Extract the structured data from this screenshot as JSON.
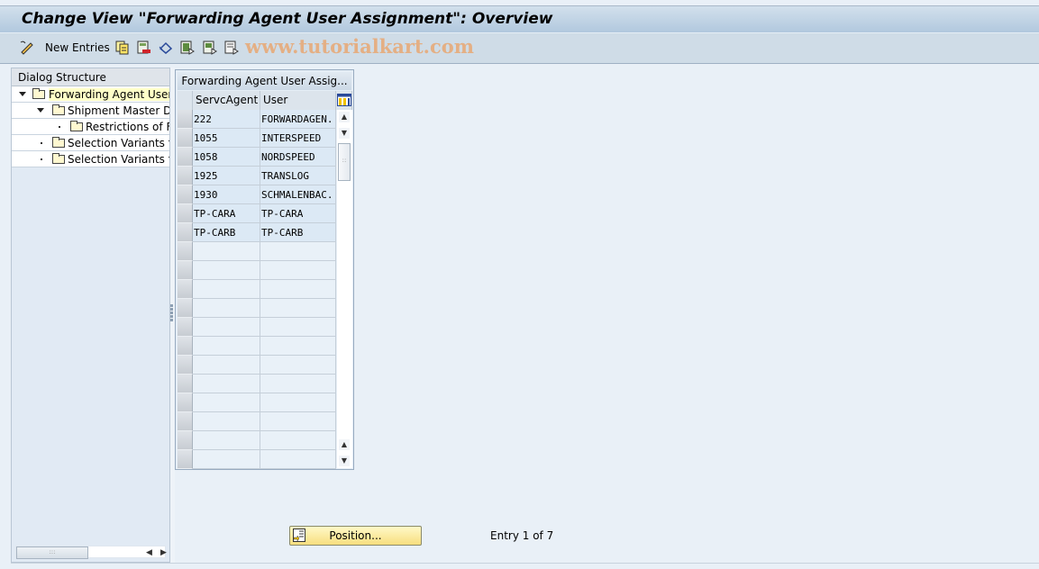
{
  "window": {
    "title": "Change View \"Forwarding Agent User Assignment\": Overview"
  },
  "toolbar": {
    "new_entries_label": "New Entries",
    "icons": [
      "change-display-icon",
      "copy-as-icon",
      "delete-icon",
      "undo-change-icon",
      "select-all-icon",
      "select-block-icon",
      "deselect-all-icon"
    ],
    "watermark": "www.tutorialkart.com"
  },
  "dialog_structure": {
    "header": "Dialog Structure",
    "items": [
      {
        "label": "Forwarding Agent User Assignment",
        "level": 0,
        "expander": "expanded",
        "selected": true
      },
      {
        "label": "Shipment Master Data",
        "level": 1,
        "expander": "expanded",
        "selected": false
      },
      {
        "label": "Restrictions of Fr",
        "level": 2,
        "expander": "leaf",
        "selected": false
      },
      {
        "label": "Selection Variants for",
        "level": 1,
        "expander": "leaf",
        "selected": false
      },
      {
        "label": "Selection Variants for",
        "level": 1,
        "expander": "leaf",
        "selected": false
      }
    ]
  },
  "table": {
    "title": "Forwarding Agent User Assig...",
    "columns": [
      "ServcAgent",
      "User"
    ],
    "rows": [
      [
        "222",
        "FORWARDAGEN."
      ],
      [
        "1055",
        "INTERSPEED"
      ],
      [
        "1058",
        "NORDSPEED"
      ],
      [
        "1925",
        "TRANSLOG"
      ],
      [
        "1930",
        "SCHMALENBAC."
      ],
      [
        "TP-CARA",
        "TP-CARA"
      ],
      [
        "TP-CARB",
        "TP-CARB"
      ],
      [
        "",
        ""
      ],
      [
        "",
        ""
      ],
      [
        "",
        ""
      ],
      [
        "",
        ""
      ],
      [
        "",
        ""
      ],
      [
        "",
        ""
      ],
      [
        "",
        ""
      ],
      [
        "",
        ""
      ],
      [
        "",
        ""
      ],
      [
        "",
        ""
      ],
      [
        "",
        ""
      ],
      [
        "",
        ""
      ]
    ]
  },
  "footer": {
    "position_button": "Position...",
    "entry_text": "Entry 1 of 7"
  }
}
